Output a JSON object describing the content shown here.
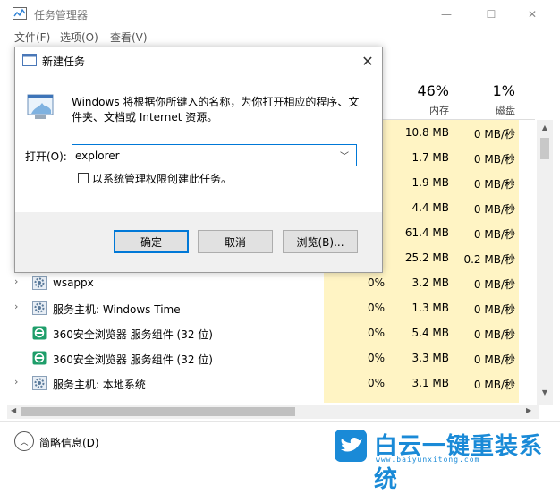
{
  "window": {
    "title": "任务管理器",
    "controls": {
      "minimize": "—",
      "maximize": "☐",
      "close": "✕"
    }
  },
  "menu": {
    "items": [
      {
        "label": "文件(F)"
      },
      {
        "label": "选项(O)"
      },
      {
        "label": "查看(V)"
      }
    ]
  },
  "columns": {
    "memory": {
      "percent": "46%",
      "name": "内存"
    },
    "disk": {
      "percent": "1%",
      "name": "磁盘"
    }
  },
  "rows": [
    {
      "name": "",
      "cpu": "",
      "mem": "10.8 MB",
      "disk": "0 MB/秒",
      "expander": "",
      "icon": ""
    },
    {
      "name": "",
      "cpu": "",
      "mem": "1.7 MB",
      "disk": "0 MB/秒",
      "expander": "",
      "icon": ""
    },
    {
      "name": "",
      "cpu": "",
      "mem": "1.9 MB",
      "disk": "0 MB/秒",
      "expander": "",
      "icon": ""
    },
    {
      "name": "",
      "cpu": "",
      "mem": "4.4 MB",
      "disk": "0 MB/秒",
      "expander": "",
      "icon": ""
    },
    {
      "name": "",
      "cpu": "",
      "mem": "61.4 MB",
      "disk": "0 MB/秒",
      "expander": "",
      "icon": ""
    },
    {
      "name": "",
      "cpu": "",
      "mem": "25.2 MB",
      "disk": "0.2 MB/秒",
      "expander": "",
      "icon": ""
    },
    {
      "name": "wsappx",
      "cpu": "0%",
      "mem": "3.2 MB",
      "disk": "0 MB/秒",
      "expander": "›",
      "icon": "gear-icon"
    },
    {
      "name": "服务主机: Windows Time",
      "cpu": "0%",
      "mem": "1.3 MB",
      "disk": "0 MB/秒",
      "expander": "›",
      "icon": "gear-icon"
    },
    {
      "name": "360安全浏览器 服务组件 (32 位)",
      "cpu": "0%",
      "mem": "5.4 MB",
      "disk": "0 MB/秒",
      "expander": "",
      "icon": "browser-icon"
    },
    {
      "name": "360安全浏览器 服务组件 (32 位)",
      "cpu": "0%",
      "mem": "3.3 MB",
      "disk": "0 MB/秒",
      "expander": "",
      "icon": "browser-icon"
    },
    {
      "name": "服务主机: 本地系统",
      "cpu": "0%",
      "mem": "3.1 MB",
      "disk": "0 MB/秒",
      "expander": "›",
      "icon": "gear-icon"
    }
  ],
  "footer": {
    "brief_label": "简略信息(D)",
    "brief_icon": "chevron-up-icon"
  },
  "watermark": {
    "text": "白云一键重装系统",
    "url": "www.baiyunxitong.com"
  },
  "dialog": {
    "title": "新建任务",
    "close": "✕",
    "description": "Windows 将根据你所键入的名称，为你打开相应的程序、文件夹、文档或 Internet 资源。",
    "open_label": "打开(O):",
    "open_value": "explorer",
    "admin_checkbox_label": "以系统管理权限创建此任务。",
    "admin_checked": false,
    "buttons": {
      "ok": "确定",
      "cancel": "取消",
      "browse": "浏览(B)..."
    }
  },
  "colors": {
    "accent": "#0078d7",
    "column_highlight": "#fff4c4",
    "watermark_blue": "#1a8ad7"
  }
}
